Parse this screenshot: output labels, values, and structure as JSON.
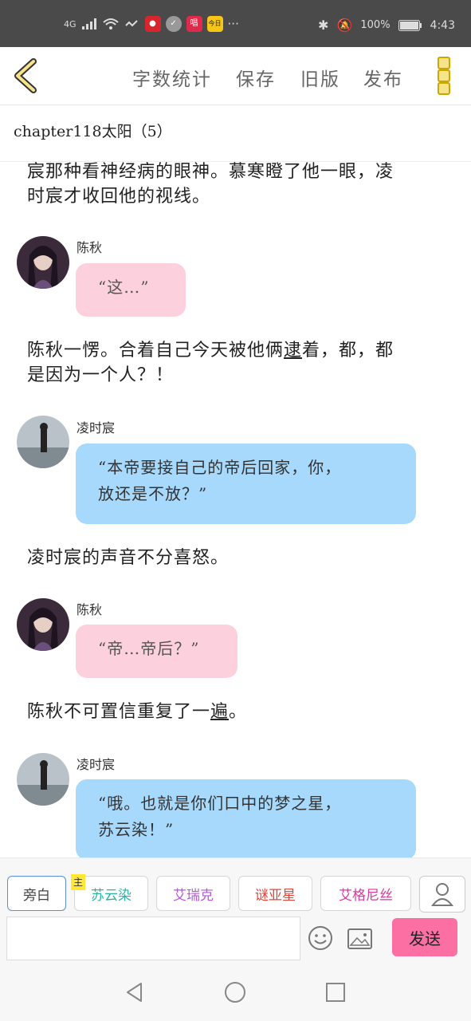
{
  "status": {
    "network": "4G",
    "battery": "100%",
    "time": "4:43",
    "badge_music": "唱",
    "badge_news": "今日"
  },
  "toolbar": {
    "word_count": "字数统计",
    "save": "保存",
    "old_version": "旧版",
    "publish": "发布"
  },
  "chapter": {
    "title": "chapter118太阳（5）"
  },
  "messages": {
    "n1_line1": "宸那种看神经病的眼神。慕寒瞪了他一眼，凌",
    "n1_line2": "时宸才收回他的视线。",
    "m1_speaker": "陈秋",
    "m1_text": "“这…”",
    "n2_line1a": "陈秋一愣。合着自己今天被他俩",
    "n2_line1b": "逮",
    "n2_line1c": "着，都，都",
    "n2_line2": "是因为一个人？！",
    "m2_speaker": "凌时宸",
    "m2_line1": "“本帝要接自己的帝后回家，你，",
    "m2_line2": "放还是不放？”",
    "n3": "凌时宸的声音不分喜怒。",
    "m3_speaker": "陈秋",
    "m3_text": "“帝…帝后？”",
    "n4a": "陈秋不可置信重复了一",
    "n4b": "遍",
    "n4c": "。",
    "m4_speaker": "凌时宸",
    "m4_line1": "“哦。也就是你们口中的梦之星，",
    "m4_line2": "苏云染！”"
  },
  "roles": {
    "aside": "旁白",
    "role1": "苏云染",
    "role1_badge": "主",
    "role2": "艾瑞克",
    "role3": "谜亚星",
    "role4": "艾格尼丝"
  },
  "composer": {
    "input_value": "",
    "send": "发送"
  },
  "colors": {
    "pink_bubble": "#fcd0dd",
    "blue_bubble": "#a6d9fb",
    "send_button": "#fb6fa3",
    "accent_yellow": "#f7e38a",
    "role1": "#2bb3a6",
    "role2": "#b25bd6",
    "role3": "#e0453a",
    "role4": "#d63c9a"
  },
  "icons": [
    "back-icon",
    "more-icon",
    "user-icon",
    "emoji-icon",
    "image-icon",
    "nav-back-icon",
    "nav-home-icon",
    "nav-recent-icon"
  ]
}
